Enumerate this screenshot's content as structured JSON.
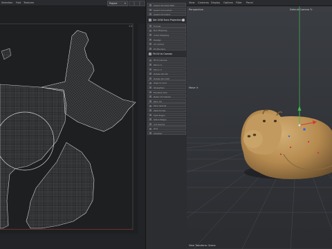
{
  "uv_editor": {
    "menu": [
      "Selection",
      "Fold",
      "Textures"
    ],
    "canvas_mode": "Project",
    "grid_corner_label": "1.0"
  },
  "tool_panel": {
    "items": [
      {
        "label": "Select Shortest Path",
        "kind": "item"
      },
      {
        "label": "Select Connected",
        "kind": "item"
      },
      {
        "label": "Select UV Island",
        "kind": "item"
      },
      {
        "label": "Set UVW from Projection",
        "kind": "section"
      },
      {
        "label": "Frontal",
        "kind": "item"
      },
      {
        "label": "Box Mapping",
        "kind": "item"
      },
      {
        "label": "Cubic Mapping",
        "kind": "item"
      },
      {
        "label": "Realign",
        "kind": "item"
      },
      {
        "label": "UV Unfold",
        "kind": "item"
      },
      {
        "label": "Pin Borders",
        "kind": "item"
      },
      {
        "label": "Fit UV to Canvas",
        "kind": "section"
      },
      {
        "label": "Fit to Canvas",
        "kind": "item"
      },
      {
        "label": "Mirror U",
        "kind": "item"
      },
      {
        "label": "Mirror V",
        "kind": "item"
      },
      {
        "label": "Rotate 90 CW",
        "kind": "item"
      },
      {
        "label": "Rotate 90 CCW",
        "kind": "item"
      },
      {
        "label": "Align to Grid",
        "kind": "item"
      },
      {
        "label": "Straighten",
        "kind": "item"
      },
      {
        "label": "Equalize Size",
        "kind": "item"
      },
      {
        "label": "Relax UV Islands",
        "kind": "item"
      },
      {
        "label": "Pack UV",
        "kind": "item"
      },
      {
        "label": "Pack Islands",
        "kind": "item"
      },
      {
        "label": "Weld Points",
        "kind": "item"
      },
      {
        "label": "Split Edges",
        "kind": "item"
      },
      {
        "label": "Stitch Edges",
        "kind": "item"
      },
      {
        "label": "Cut Seams",
        "kind": "item"
      },
      {
        "label": "Grid",
        "kind": "item"
      },
      {
        "label": "Checker",
        "kind": "item"
      }
    ]
  },
  "viewport": {
    "menu": [
      "View",
      "Cameras",
      "Display",
      "Options",
      "Filter",
      "Panel"
    ],
    "view_name": "Perspective",
    "camera_name": "Default Camera ↻",
    "tool_label": "Move ✕",
    "status": "View Transform: Scene"
  }
}
